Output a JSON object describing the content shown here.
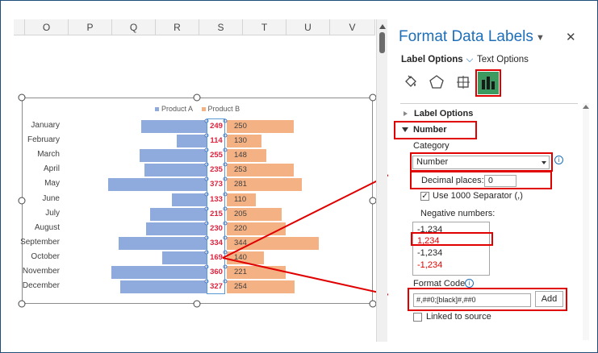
{
  "columns": [
    "O",
    "P",
    "Q",
    "R",
    "S",
    "T",
    "U",
    "V"
  ],
  "chart_data": {
    "type": "bar",
    "legend": [
      "Product A",
      "Product B"
    ],
    "categories": [
      "January",
      "February",
      "March",
      "April",
      "May",
      "June",
      "July",
      "August",
      "September",
      "October",
      "November",
      "December"
    ],
    "series": [
      {
        "name": "Product A",
        "values": [
          249,
          114,
          255,
          235,
          373,
          133,
          215,
          230,
          334,
          169,
          360,
          327
        ]
      },
      {
        "name": "Product B",
        "values": [
          250,
          130,
          148,
          253,
          281,
          110,
          205,
          220,
          344,
          140,
          221,
          254
        ]
      }
    ],
    "label_a_text": [
      "249",
      "114",
      "255",
      "235",
      "373",
      "133",
      "215",
      "230",
      "334",
      "169",
      "360",
      "327"
    ],
    "label_b_text": [
      "250",
      "130",
      "148",
      "253",
      "281",
      "110",
      "205",
      "220",
      "344",
      "140",
      "221",
      "254"
    ]
  },
  "colors": {
    "product_a": "#8faadc",
    "product_b": "#f4b183",
    "highlight": "#e00000",
    "accent": "#1e6fb8"
  },
  "pane": {
    "title": "Format Data Labels",
    "dropdown_icon": "chevron-down-icon",
    "close": "✕",
    "tab_label_options": "Label Options",
    "tab_text_options": "Text Options",
    "icons": [
      "fill-line-icon",
      "effects-pentagon-icon",
      "size-properties-icon",
      "label-options-chart-icon"
    ],
    "section_label_options": "Label Options",
    "section_number": "Number",
    "category_label": "Category",
    "category_value": "Number",
    "decimal_label": "Decimal places:",
    "decimal_value": "0",
    "separator_label": "Use 1000 Separator (,)",
    "negative_label": "Negative numbers:",
    "negative_options": [
      "-1,234",
      "1,234",
      "-1,234",
      "-1,234"
    ],
    "format_code_label": "Format Code",
    "format_code_value": "#,##0;[black]#,##0",
    "add_button": "Add",
    "linked_label": "Linked to source"
  }
}
